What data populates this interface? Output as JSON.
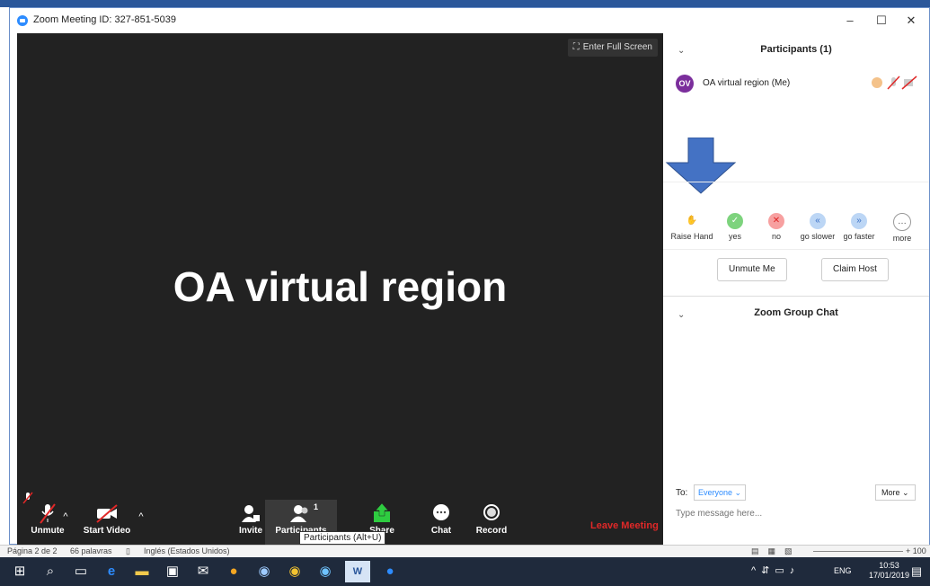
{
  "window": {
    "title": "Zoom Meeting ID: 327-851-5039",
    "min": "–",
    "max": "☐",
    "close": "✕"
  },
  "video": {
    "fullscreen_label": "Enter Full Screen",
    "speaker_name": "OA virtual region"
  },
  "toolbar": {
    "unmute": "Unmute",
    "start_video": "Start Video",
    "invite": "Invite",
    "participants": "Participants",
    "participants_count": "1",
    "share": "Share",
    "chat": "Chat",
    "record": "Record",
    "leave": "Leave Meeting",
    "tooltip": "Participants (Alt+U)"
  },
  "participants": {
    "header": "Participants (1)",
    "list": [
      {
        "initials": "OV",
        "name": "OA virtual region  (Me)"
      }
    ],
    "reactions": [
      "Raise Hand",
      "yes",
      "no",
      "go slower",
      "go faster",
      "more"
    ],
    "unmute_me": "Unmute Me",
    "claim_host": "Claim Host"
  },
  "chat": {
    "header": "Zoom Group Chat",
    "to_label": "To:",
    "to_value": "Everyone",
    "more": "More",
    "placeholder": "Type message here..."
  },
  "word_status": {
    "page": "Página 2 de 2",
    "words": "66 palavras",
    "language": "Inglés (Estados Unidos)",
    "zoom": "+ 100"
  },
  "taskbar": {
    "lang": "ENG",
    "time": "10:53",
    "date": "17/01/2019"
  },
  "colors": {
    "accent": "#2d8cff",
    "leave": "#e02828",
    "arrow": "#4472c4",
    "avatar": "#7b2e9c"
  }
}
